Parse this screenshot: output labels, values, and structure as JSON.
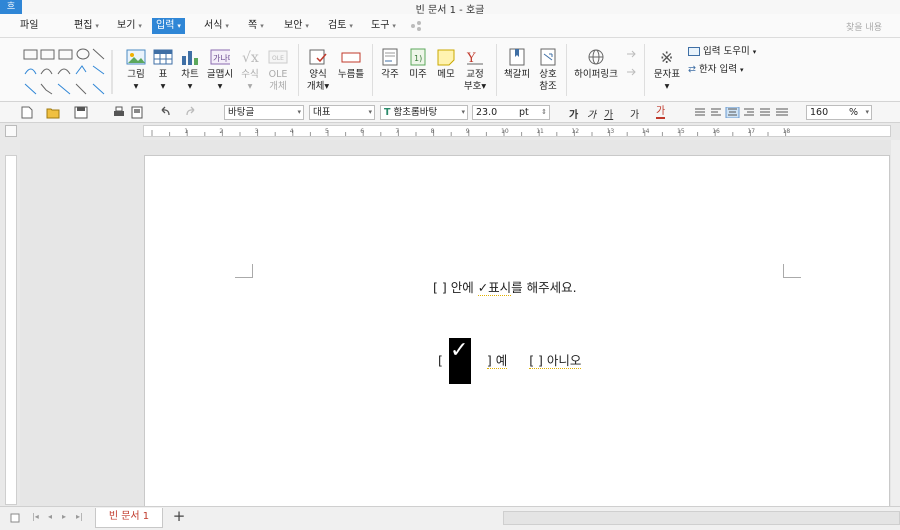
{
  "window": {
    "title": "빈 문서 1 - 호글",
    "logo": "흐"
  },
  "menu": {
    "items": [
      {
        "label": "파일",
        "arrow": ""
      },
      {
        "label": "편집",
        "arrow": "▾"
      },
      {
        "label": "보기",
        "arrow": "▾"
      },
      {
        "label": "입력",
        "arrow": "▾"
      },
      {
        "label": "서식",
        "arrow": "▾"
      },
      {
        "label": "쪽",
        "arrow": "▾"
      },
      {
        "label": "보안",
        "arrow": "▾"
      },
      {
        "label": "검토",
        "arrow": "▾"
      },
      {
        "label": "도구",
        "arrow": "▾"
      }
    ],
    "search_placeholder": "찾을 내용"
  },
  "ribbon": {
    "picture": "그림",
    "table": "표",
    "chart": "차트",
    "wordart": "글맵시",
    "formula": "수식",
    "ole_line1": "OLE",
    "ole_line2": "개체",
    "form_line1": "양식",
    "form_line2": "개체▾",
    "button": "누름틀",
    "footnote_label1": "각주",
    "endnote": "미주",
    "memo": "메모",
    "proof_line1": "교정",
    "proof_line2": "부호▾",
    "bookmark": "책갈피",
    "crossref_line1": "상호",
    "crossref_line2": "참조",
    "hyperlink": "하이퍼링크",
    "symbol": "문자표",
    "input_helper": "입력 도우미",
    "hanja_input": "한자 입력"
  },
  "format_bar": {
    "style": "바탕글",
    "language": "대표",
    "font": "함초롬바탕",
    "size": "23.0",
    "size_unit": "pt",
    "zoom": "160",
    "zoom_unit": "%",
    "bold": "가",
    "italic": "가",
    "underline": "가",
    "strike": "가",
    "color": "가"
  },
  "ruler": {
    "ticks": [
      "1",
      "2",
      "3",
      "4",
      "5",
      "6",
      "7",
      "8",
      "9",
      "10",
      "11",
      "12",
      "13",
      "14",
      "15",
      "16",
      "17",
      "18"
    ]
  },
  "document": {
    "line1_before": "[   ] 안에 ",
    "line1_check": "✓표시",
    "line1_after": "를 해주세요.",
    "line2_open": "[",
    "checkbox_mark": "✓",
    "line2_yes": "] 예",
    "line2_no": "[    ] 아니오"
  },
  "tabs": {
    "doc_tab": "빈 문서 1",
    "add": "+"
  }
}
